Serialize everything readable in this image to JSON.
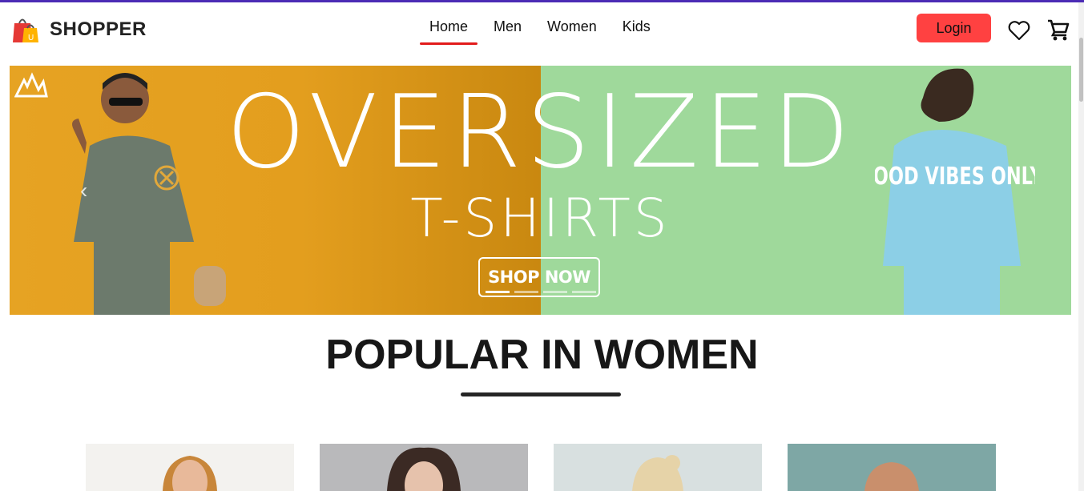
{
  "header": {
    "brand": "SHOPPER",
    "menu": [
      {
        "label": "Home",
        "active": true
      },
      {
        "label": "Men",
        "active": false
      },
      {
        "label": "Women",
        "active": false
      },
      {
        "label": "Kids",
        "active": false
      }
    ],
    "login_label": "Login",
    "icons": [
      "shopping-bag-logo-icon",
      "heart-icon",
      "cart-icon"
    ]
  },
  "banner": {
    "headline": "OVERSIZED",
    "subheadline": "T-SHIRTS",
    "cta": "SHOP NOW",
    "shirt_text": "GOOD VIBES ONLY",
    "colors": {
      "left": "#e3a020",
      "right": "#9fd99b"
    },
    "slides": 4,
    "active_slide": 1
  },
  "section": {
    "title": "POPULAR IN WOMEN"
  },
  "products": [
    {
      "bg": "#f3f2ef"
    },
    {
      "bg": "#b9b9bb"
    },
    {
      "bg": "#d8e0e0"
    },
    {
      "bg": "#7ea7a5"
    }
  ],
  "accent": "#ff4141",
  "top_border": "#4b2bb5"
}
